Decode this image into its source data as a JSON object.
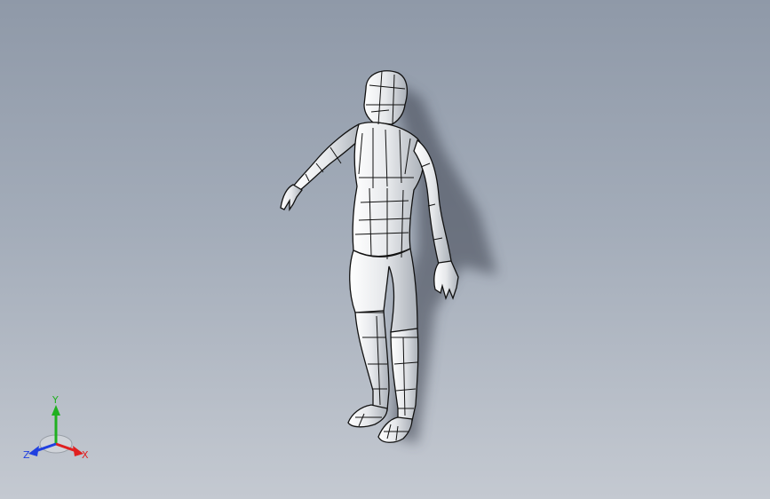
{
  "viewport": {
    "background_top": "#8f99a8",
    "background_bottom": "#c4c9d1"
  },
  "model": {
    "icon": "human-figure-wireframe-model",
    "surface_color": "#eef0f2",
    "edge_color": "#111111"
  },
  "triad": {
    "x_label": "X",
    "y_label": "Y",
    "z_label": "Z",
    "x_color": "#e02020",
    "y_color": "#20b020",
    "z_color": "#2040e0"
  }
}
